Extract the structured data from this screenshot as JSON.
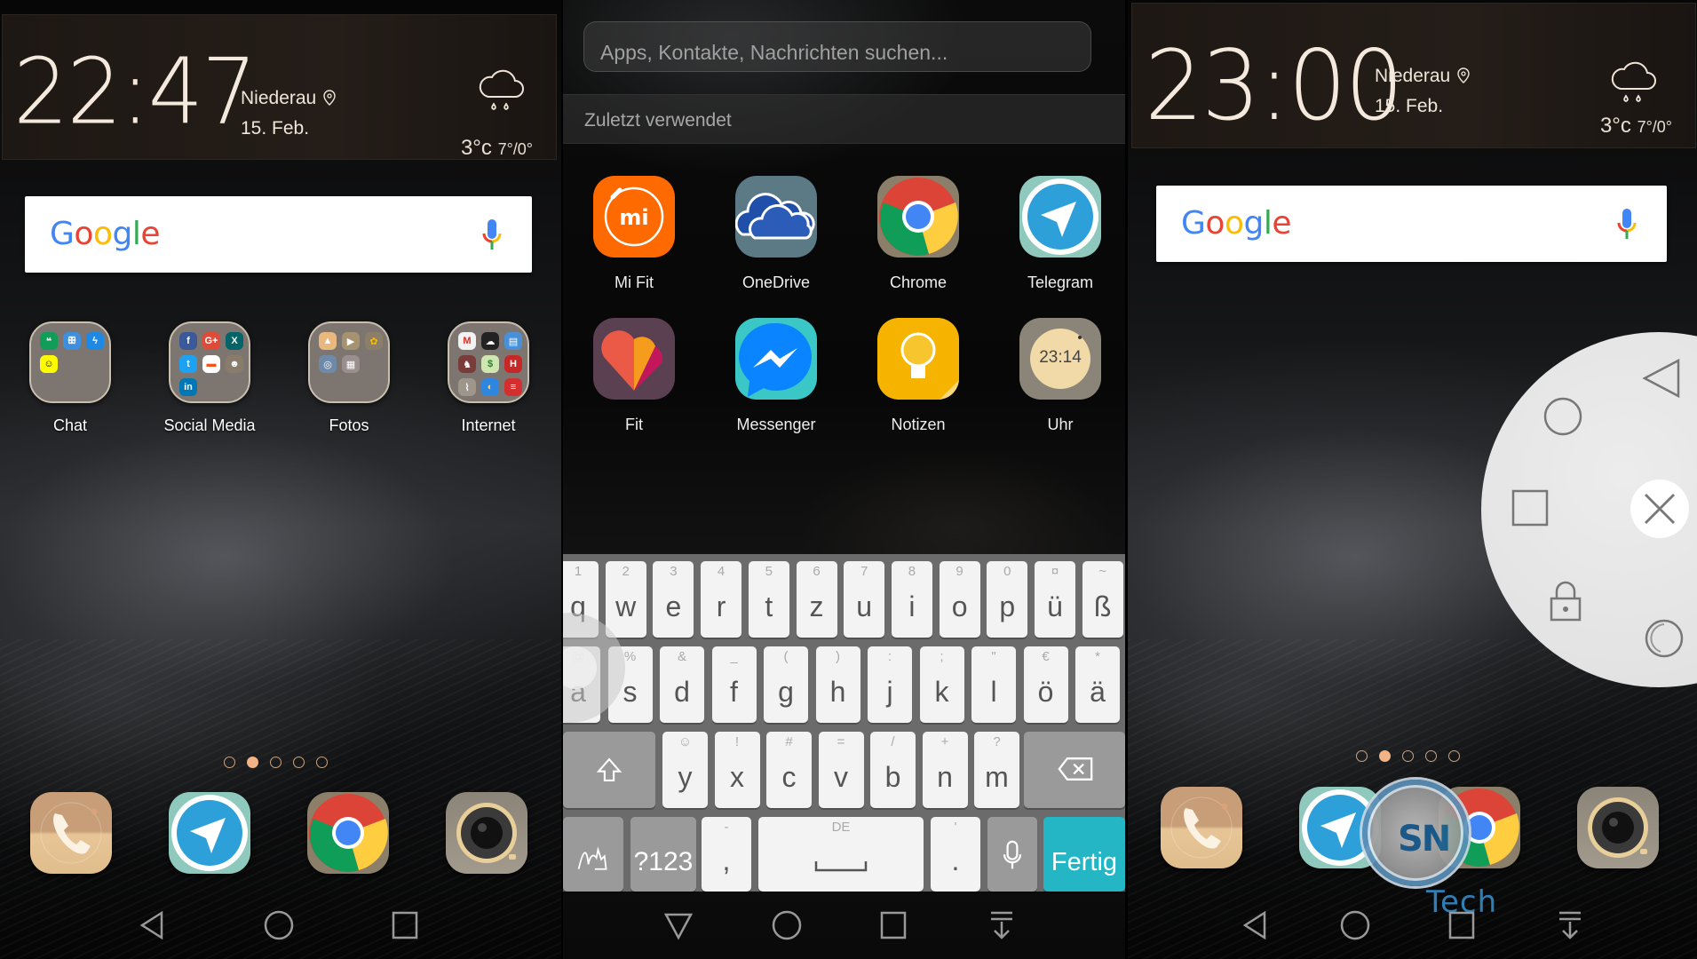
{
  "screens": {
    "left": {
      "clock": {
        "hours": "22",
        "minutes": "47",
        "location": "Niederau",
        "date": "15. Feb.",
        "temp": "3°c",
        "range": "7°/0°",
        "weather": "rain-cloud"
      },
      "google": {
        "logo": [
          "G",
          "o",
          "o",
          "g",
          "l",
          "e"
        ]
      },
      "folders": [
        {
          "label": "Chat",
          "apps": [
            "Hangouts",
            "Meetup",
            "Messenger",
            "Snapchat"
          ]
        },
        {
          "label": "Social Media",
          "apps": [
            "Facebook",
            "Google+",
            "Xing",
            "Twitter",
            "Slides",
            "Contacts",
            "LinkedIn"
          ]
        },
        {
          "label": "Fotos",
          "apps": [
            "Gallery",
            "Video",
            "Photos",
            "Camera",
            "QR"
          ]
        },
        {
          "label": "Internet",
          "apps": [
            "Gmail",
            "Weather",
            "Calendar",
            "Reader",
            "Sheets",
            "H",
            "Maps",
            "Weather2",
            "News"
          ]
        }
      ],
      "page_indicator": {
        "count": 5,
        "active": 2
      },
      "dock": [
        "Telefon",
        "Telegram",
        "Chrome",
        "Kamera"
      ],
      "nav": [
        "back",
        "home",
        "recents"
      ]
    },
    "middle": {
      "search_placeholder": "Apps, Kontakte, Nachrichten suchen...",
      "section_title": "Zuletzt verwendet",
      "apps": [
        {
          "label": "Mi Fit"
        },
        {
          "label": "OneDrive"
        },
        {
          "label": "Chrome"
        },
        {
          "label": "Telegram"
        },
        {
          "label": "Fit"
        },
        {
          "label": "Messenger"
        },
        {
          "label": "Notizen"
        },
        {
          "label": "Uhr",
          "clock_face": "23:14"
        }
      ],
      "keyboard": {
        "row1": [
          [
            "1",
            "q"
          ],
          [
            "2",
            "w"
          ],
          [
            "3",
            "e"
          ],
          [
            "4",
            "r"
          ],
          [
            "5",
            "t"
          ],
          [
            "6",
            "z"
          ],
          [
            "7",
            "u"
          ],
          [
            "8",
            "i"
          ],
          [
            "9",
            "o"
          ],
          [
            "0",
            "p"
          ],
          [
            "¤",
            "ü"
          ],
          [
            "~",
            "ß"
          ]
        ],
        "row2": [
          [
            "@",
            "a"
          ],
          [
            "%",
            "s"
          ],
          [
            "&",
            "d"
          ],
          [
            "_",
            "f"
          ],
          [
            "(",
            "g"
          ],
          [
            ")",
            "h"
          ],
          [
            ":",
            "j"
          ],
          [
            ";",
            "k"
          ],
          [
            "\"",
            "l"
          ],
          [
            "€",
            "ö"
          ],
          [
            "*",
            "ä"
          ]
        ],
        "row3": [
          [
            "☺",
            "y"
          ],
          [
            "!",
            "x"
          ],
          [
            "#",
            "c"
          ],
          [
            "=",
            "v"
          ],
          [
            "/",
            "b"
          ],
          [
            "+",
            "n"
          ],
          [
            "?",
            "m"
          ]
        ],
        "symbols_label": "?123",
        "comma_hint": "-",
        "comma": ",",
        "space_label": "DE",
        "period_hint": "'",
        "period": ".",
        "enter_label": "Fertig"
      },
      "nav": [
        "hide",
        "home",
        "recents",
        "notifications"
      ]
    },
    "right": {
      "clock": {
        "hours": "23",
        "minutes": "00",
        "location": "Niederau",
        "date": "15. Feb.",
        "temp": "3°c",
        "range": "7°/0°",
        "weather": "rain-cloud"
      },
      "page_indicator": {
        "count": 5,
        "active": 2
      },
      "dock": [
        "Telefon",
        "Telegram",
        "Chrome",
        "Kamera"
      ],
      "floating_menu": [
        "back",
        "home",
        "recents",
        "close",
        "lock",
        "screenshot"
      ],
      "watermark": {
        "logo": "SN",
        "text": "Tech"
      },
      "nav": [
        "back",
        "home",
        "recents",
        "notifications"
      ]
    }
  }
}
